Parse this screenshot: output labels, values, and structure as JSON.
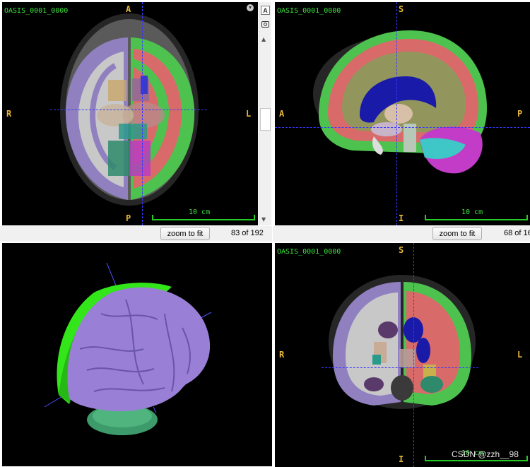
{
  "panes": {
    "axial": {
      "title": "OASIS_0001_0000",
      "top": "A",
      "bottom": "P",
      "left": "R",
      "right": "L",
      "scale": "10 cm"
    },
    "sagittal": {
      "title": "OASIS_0001_0000",
      "top": "S",
      "bottom": "I",
      "left": "A",
      "right": "P",
      "scale": "10 cm"
    },
    "coronal": {
      "title": "OASIS_0001_0000",
      "top": "S",
      "bottom": "I",
      "left": "R",
      "right": "L",
      "scale": "10 cm"
    }
  },
  "controls": {
    "zoom_label": "zoom to fit",
    "axial_slice": "83 of 192",
    "sagittal_slice": "68 of 16",
    "text_tool": "A"
  },
  "watermark": "CSDN @zzh__98",
  "colors": {
    "crosshair": "#3838ff",
    "overlay_text": "#3de03d",
    "orientation": "#e8b83a",
    "cortex_green": "#4ec24e",
    "white_matter_red": "#d96a6a",
    "ventricle_blue": "#1a1aa8",
    "cerebellum_cyan": "#3fc6c6",
    "cerebellum_magenta": "#c23cc8",
    "surface_purple": "#9a7fd6",
    "surface_green": "#33e61a"
  }
}
